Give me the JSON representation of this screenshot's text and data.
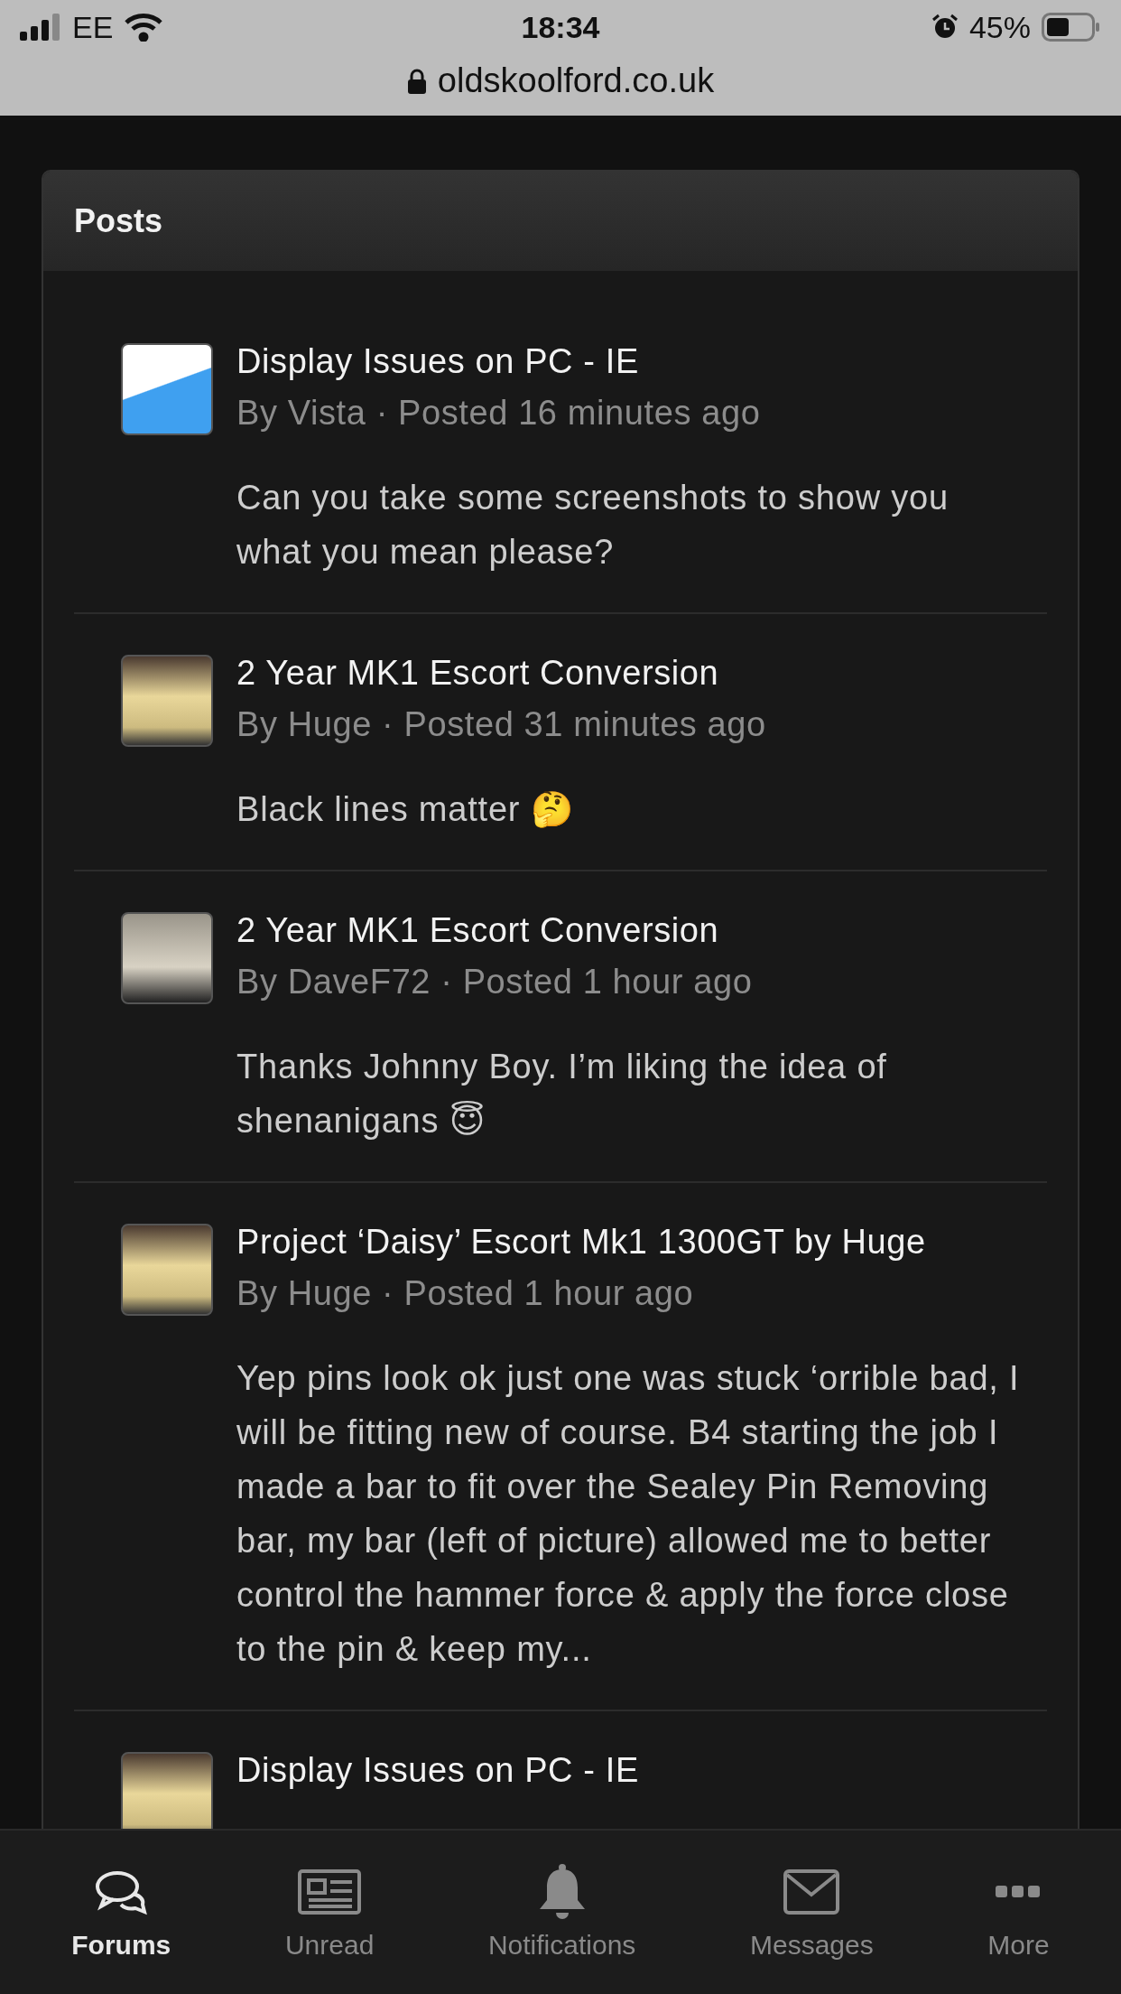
{
  "status_bar": {
    "carrier": "EE",
    "time": "18:34",
    "battery": "45%",
    "url": "oldskoolford.co.uk"
  },
  "section": {
    "title": "Posts"
  },
  "posts": [
    {
      "title": "Display Issues on PC - IE",
      "byline": "By Vista · Posted 16 minutes ago",
      "body": "Can you take some screenshots to show you what you mean please?",
      "kind": "cartoon"
    },
    {
      "title": "2 Year MK1 Escort Conversion",
      "byline": "By Huge · Posted 31 minutes ago",
      "body": "Black lines matter 🤔",
      "kind": "car"
    },
    {
      "title": "2 Year MK1 Escort Conversion",
      "byline": "By DaveF72 · Posted 1 hour ago",
      "body": "Thanks Johnny Boy. I’m liking the idea of shenanigans 😇",
      "kind": "car-front"
    },
    {
      "title": "Project ‘Daisy’ Escort Mk1 1300GT by Huge",
      "byline": "By Huge · Posted 1 hour ago",
      "body": "Yep pins look ok just one was stuck ‘orrible bad, I will be fitting new of course. B4 starting the job I made a bar to fit over the Sealey Pin Removing bar, my bar (left of picture) allowed me to better control the hammer force & apply the force close to the pin & keep my...",
      "kind": "car"
    },
    {
      "title": "Display Issues on PC - IE",
      "kind": "car"
    }
  ],
  "tabs": [
    {
      "label": "Forums",
      "kind": "chat",
      "selected": true
    },
    {
      "label": "Unread",
      "kind": "news",
      "selected": false
    },
    {
      "label": "Notifications",
      "kind": "bell",
      "selected": false
    },
    {
      "label": "Messages",
      "kind": "mail",
      "selected": false
    },
    {
      "label": "More",
      "kind": "dots",
      "selected": false
    }
  ]
}
